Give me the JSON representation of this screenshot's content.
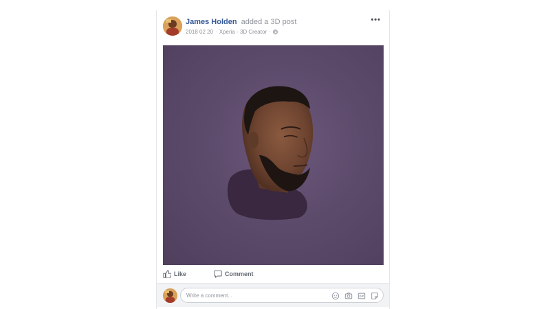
{
  "post": {
    "author": "James Holden",
    "action": "added a 3D post",
    "date": "2018 02 20",
    "separator": "·",
    "source": "Xperia - 3D Creator",
    "privacy_icon": "globe-icon",
    "more_label": "•••"
  },
  "actions": {
    "like_label": "Like",
    "comment_label": "Comment"
  },
  "comment_box": {
    "placeholder": "Write a comment...",
    "icons": [
      "emoji-icon",
      "camera-icon",
      "gif-icon",
      "sticker-icon"
    ]
  },
  "colors": {
    "author_link": "#365899",
    "meta_text": "#90949c",
    "media_background": "#5d4b6c"
  }
}
